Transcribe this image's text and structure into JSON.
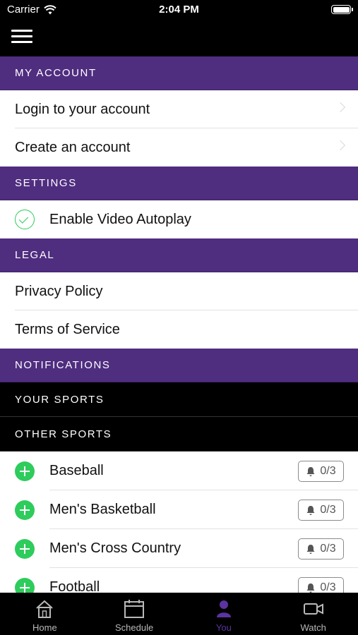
{
  "status_bar": {
    "carrier": "Carrier",
    "time": "2:04 PM"
  },
  "nav": {
    "menu_icon": "hamburger-menu-icon"
  },
  "sections": {
    "my_account": {
      "header": "MY ACCOUNT",
      "items": [
        {
          "label": "Login to your account"
        },
        {
          "label": "Create an account"
        }
      ]
    },
    "settings": {
      "header": "SETTINGS",
      "items": [
        {
          "label": "Enable Video Autoplay",
          "checked": true
        }
      ]
    },
    "legal": {
      "header": "LEGAL",
      "items": [
        {
          "label": "Privacy Policy"
        },
        {
          "label": "Terms of Service"
        }
      ]
    },
    "notifications": {
      "header": "NOTIFICATIONS"
    },
    "your_sports": {
      "header": "YOUR SPORTS"
    },
    "other_sports": {
      "header": "OTHER SPORTS",
      "items": [
        {
          "name": "Baseball",
          "count": "0/3"
        },
        {
          "name": "Men's Basketball",
          "count": "0/3"
        },
        {
          "name": "Men's Cross Country",
          "count": "0/3"
        },
        {
          "name": "Football",
          "count": "0/3"
        }
      ]
    }
  },
  "tab_bar": {
    "tabs": [
      {
        "label": "Home",
        "icon": "home-icon"
      },
      {
        "label": "Schedule",
        "icon": "calendar-icon"
      },
      {
        "label": "You",
        "icon": "person-icon",
        "active": true
      },
      {
        "label": "Watch",
        "icon": "video-camera-icon"
      }
    ]
  },
  "colors": {
    "accent": "#4f2d7f",
    "active_tab": "#5b34a0",
    "green": "#2ecc5c"
  }
}
